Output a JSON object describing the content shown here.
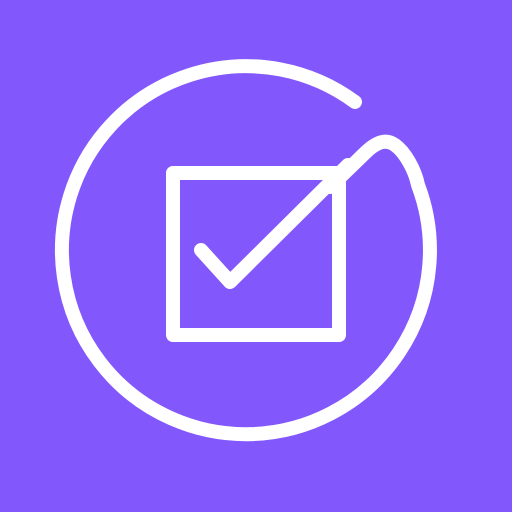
{
  "icon": {
    "name": "checkbox-in-circle-logo",
    "background_color": "#8257FB",
    "stroke_color": "#FFFFFF"
  }
}
